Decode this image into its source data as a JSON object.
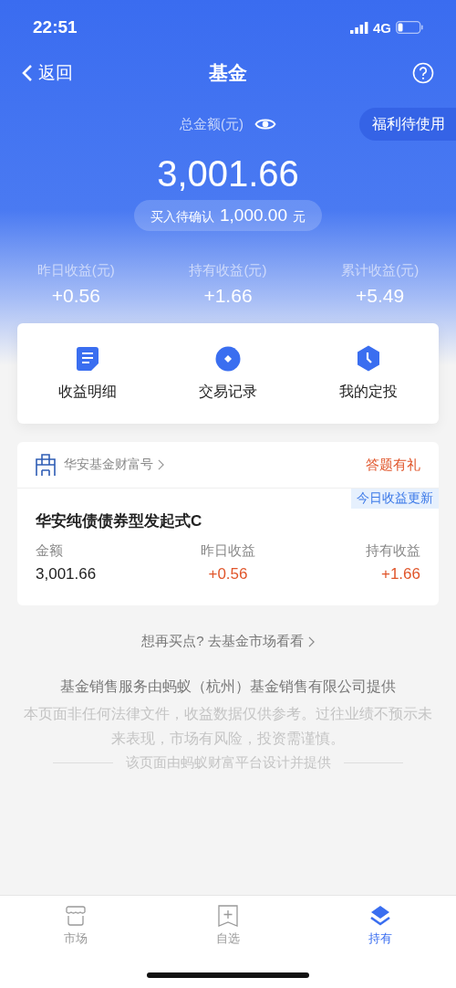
{
  "status_bar": {
    "time": "22:51",
    "network": "4G"
  },
  "nav": {
    "back": "返回",
    "title": "基金"
  },
  "summary": {
    "label": "总金额(元)",
    "badge": "福利待使用",
    "total": "3,001.66",
    "pending": {
      "label": "买入待确认",
      "amount": "1,000.00",
      "unit": "元"
    },
    "stats": [
      {
        "label": "昨日收益(元)",
        "value": "+0.56"
      },
      {
        "label": "持有收益(元)",
        "value": "+1.66"
      },
      {
        "label": "累计收益(元)",
        "value": "+5.49"
      }
    ]
  },
  "actions": [
    {
      "kind": "detail",
      "label": "收益明细"
    },
    {
      "kind": "record",
      "label": "交易记录"
    },
    {
      "kind": "plan",
      "label": "我的定投"
    }
  ],
  "fund_card": {
    "provider": "华安基金财富号",
    "promo": "答题有礼",
    "tag": "今日收益更新",
    "name": "华安纯债债券型发起式C",
    "fields": [
      {
        "label": "金额",
        "value": "3,001.66",
        "kind": "plain"
      },
      {
        "label": "昨日收益",
        "value": "+0.56",
        "kind": "gain"
      },
      {
        "label": "持有收益",
        "value": "+1.66",
        "kind": "gain"
      }
    ]
  },
  "market_link": "想再买点? 去基金市场看看",
  "disclaimer": {
    "provider": "基金销售服务由蚂蚁（杭州）基金销售有限公司提供",
    "notice": "本页面非任何法律文件，收益数据仅供参考。过往业绩不预示未来表现，市场有风险，投资需谨慎。",
    "credit": "该页面由蚂蚁财富平台设计并提供"
  },
  "tab_bar": [
    {
      "kind": "market",
      "label": "市场",
      "selected": false
    },
    {
      "kind": "watch",
      "label": "自选",
      "selected": false
    },
    {
      "kind": "holding",
      "label": "持有",
      "selected": true
    }
  ]
}
